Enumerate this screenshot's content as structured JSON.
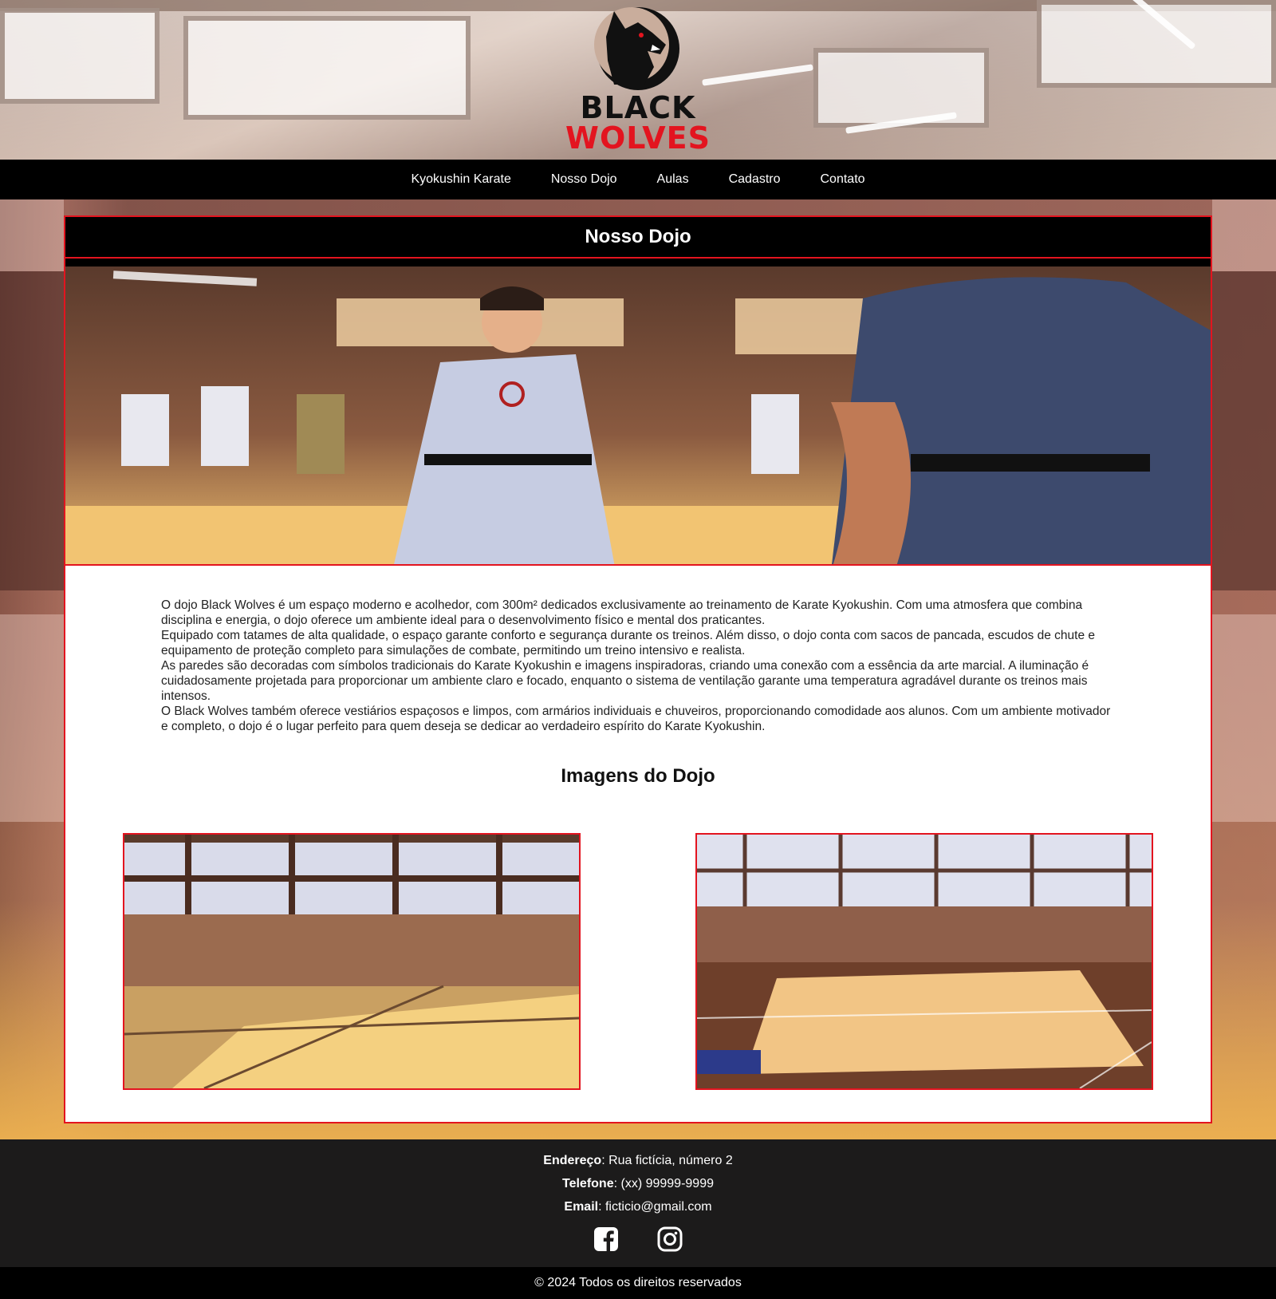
{
  "brand": {
    "line1": "BLACK",
    "line2": "WOLVES",
    "accent": "#e3141f"
  },
  "nav": {
    "items": [
      {
        "label": "Kyokushin Karate"
      },
      {
        "label": "Nosso Dojo"
      },
      {
        "label": "Aulas"
      },
      {
        "label": "Cadastro"
      },
      {
        "label": "Contato"
      }
    ]
  },
  "main": {
    "title": "Nosso Dojo",
    "paragraphs": [
      "O dojo Black Wolves é um espaço moderno e acolhedor, com 300m² dedicados exclusivamente ao treinamento de Karate Kyokushin. Com uma atmosfera que combina disciplina e energia, o dojo oferece um ambiente ideal para o desenvolvimento físico e mental dos praticantes.",
      "Equipado com tatames de alta qualidade, o espaço garante conforto e segurança durante os treinos. Além disso, o dojo conta com sacos de pancada, escudos de chute e equipamento de proteção completo para simulações de combate, permitindo um treino intensivo e realista.",
      "As paredes são decoradas com símbolos tradicionais do Karate Kyokushin e imagens inspiradoras, criando uma conexão com a essência da arte marcial. A iluminação é cuidadosamente projetada para proporcionar um ambiente claro e focado, enquanto o sistema de ventilação garante uma temperatura agradável durante os treinos mais intensos.",
      "O Black Wolves também oferece vestiários espaçosos e limpos, com armários individuais e chuveiros, proporcionando comodidade aos alunos. Com um ambiente motivador e completo, o dojo é o lugar perfeito para quem deseja se dedicar ao verdadeiro espírito do Karate Kyokushin."
    ],
    "gallery_title": "Imagens do Dojo"
  },
  "footer": {
    "address_label": "Endereço",
    "address_value": ": Rua fictícia, número 2",
    "phone_label": "Telefone",
    "phone_value": ": (xx) 99999-9999",
    "email_label": "Email",
    "email_value": ": ficticio@gmail.com",
    "social_icons": [
      "facebook-icon",
      "instagram-icon"
    ],
    "copyright": "© 2024 Todos os direitos reservados"
  }
}
